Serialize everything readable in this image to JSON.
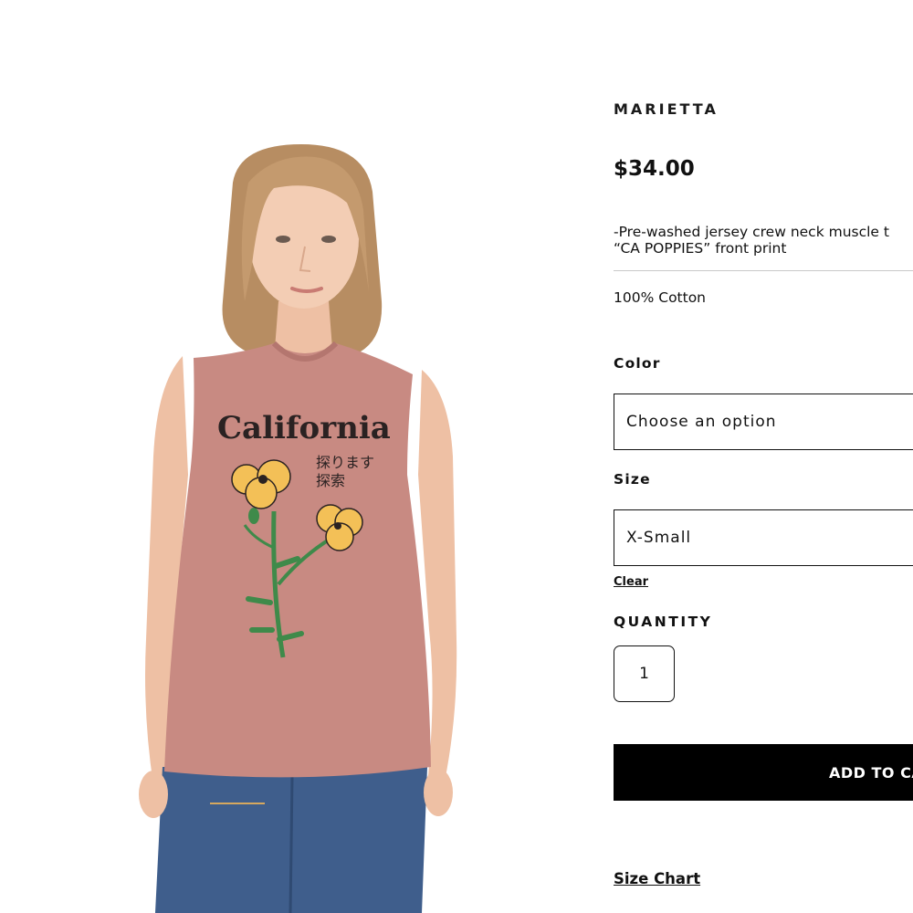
{
  "product": {
    "brand": "MARIETTA",
    "price": "$34.00",
    "description_line1": "-Pre-washed jersey crew neck muscle t",
    "description_line2": "“CA POPPIES” front print",
    "material": "100% Cotton",
    "image_print_title": "California",
    "image_print_jp_line1": "探ります",
    "image_print_jp_line2": "探索"
  },
  "options": {
    "color_label": "Color",
    "color_placeholder": "Choose an option",
    "size_label": "Size",
    "size_selected": "X-Small",
    "clear_label": "Clear"
  },
  "quantity": {
    "label": "QUANTITY",
    "value": "1"
  },
  "actions": {
    "add_to_cart_label": "ADD TO CA",
    "size_chart_label": "Size Chart"
  },
  "colors": {
    "shirt": "#c88a82",
    "button_bg": "#000000",
    "poppy": "#f3c057",
    "stem": "#3f8a4a"
  }
}
